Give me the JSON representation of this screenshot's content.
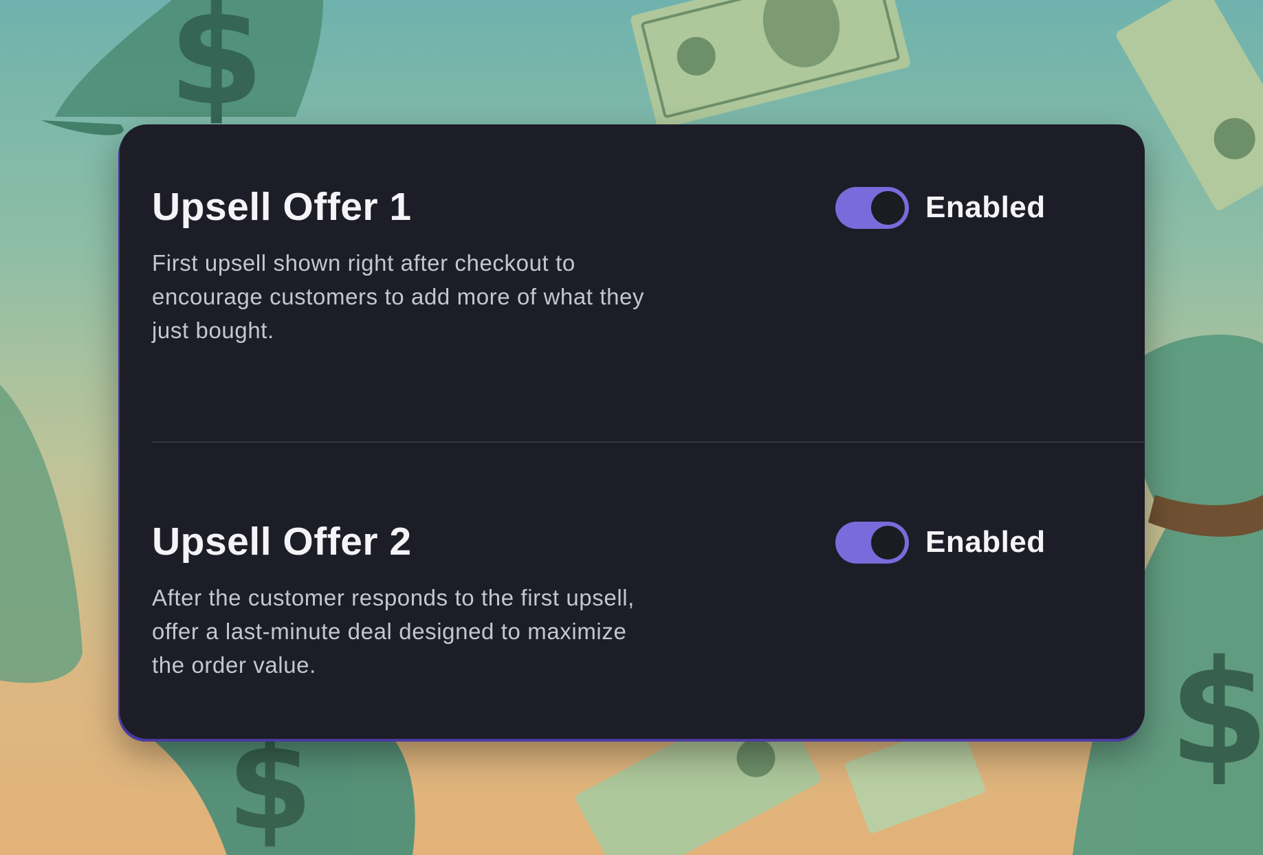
{
  "offers": [
    {
      "title": "Upsell Offer 1",
      "description": "First upsell shown right after checkout to encourage customers to add more of what they just bought.",
      "toggle": {
        "state": "on",
        "label": "Enabled"
      }
    },
    {
      "title": "Upsell Offer 2",
      "description": "After the customer responds to the first upsell, offer a last-minute deal designed to maximize the order value.",
      "toggle": {
        "state": "on",
        "label": "Enabled"
      }
    }
  ],
  "colors": {
    "card_background": "#1d1d28",
    "toggle_accent": "#7a6bdb",
    "title_text": "#f4f4f8",
    "description_text": "#c6c6d0"
  },
  "background": {
    "description_icons": [
      "money-bag-icon",
      "dollar-bill-icon"
    ]
  }
}
